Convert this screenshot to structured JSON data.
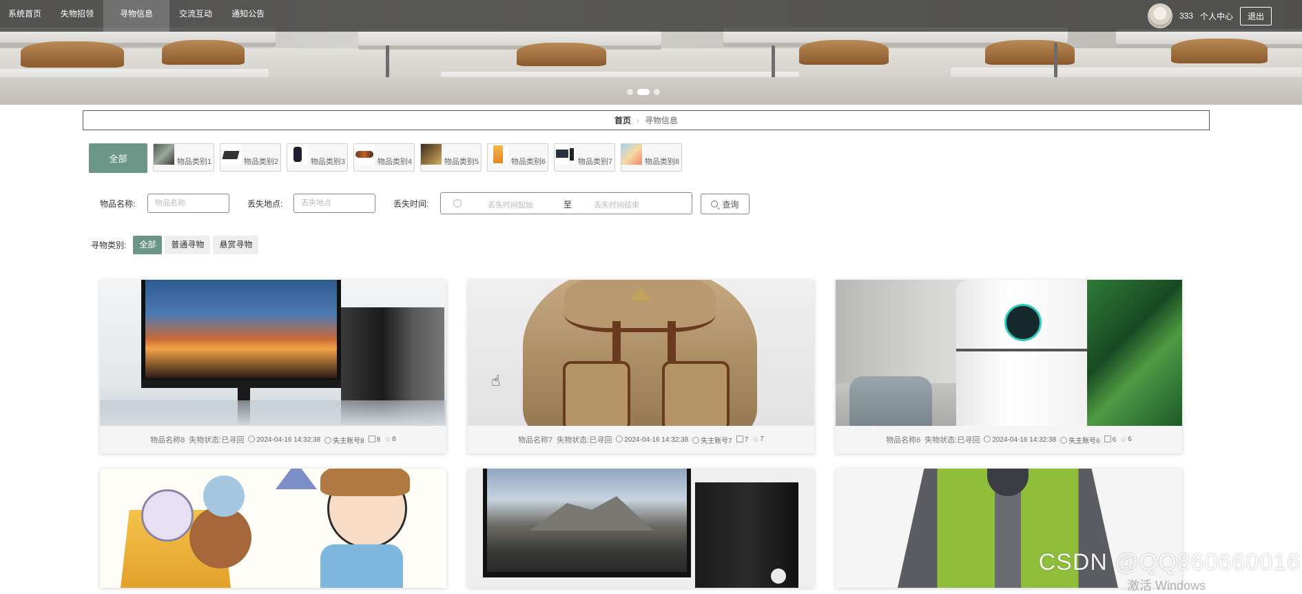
{
  "nav": {
    "items": [
      "系统首页",
      "失物招领",
      "寻物信息",
      "交流互动",
      "通知公告"
    ],
    "active_index": 2,
    "username": "333",
    "profile_label": "个人中心",
    "logout_label": "退出"
  },
  "carousel": {
    "count": 3,
    "active": 1
  },
  "breadcrumb": {
    "home": "首页",
    "sep": "›",
    "current": "寻物信息"
  },
  "categories": {
    "all_label": "全部",
    "items": [
      "物品类别1",
      "物品类别2",
      "物品类别3",
      "物品类别4",
      "物品类别5",
      "物品类别6",
      "物品类别7",
      "物品类别8"
    ]
  },
  "filters": {
    "name_label": "物品名称:",
    "name_placeholder": "物品名称",
    "place_label": "丢失地点:",
    "place_placeholder": "丢失地点",
    "time_label": "丢失时间:",
    "time_start_placeholder": "丢失时间起始",
    "time_to": "至",
    "time_end_placeholder": "丢失时间结束",
    "search_label": "查询"
  },
  "types": {
    "label": "寻物类别:",
    "items": [
      "全部",
      "普通寻物",
      "悬赏寻物"
    ],
    "active_index": 0
  },
  "cards": [
    {
      "name": "物品名称8",
      "status": "失物状态:已寻回",
      "time": "2024-04-16 14:32:38",
      "owner": "失主账号8",
      "likes": "8",
      "favs": "8"
    },
    {
      "name": "物品名称7",
      "status": "失物状态:已寻回",
      "time": "2024-04-16 14:32:38",
      "owner": "失主账号7",
      "likes": "7",
      "favs": "7"
    },
    {
      "name": "物品名称6",
      "status": "失物状态:已寻回",
      "time": "2024-04-16 14:32:38",
      "owner": "失主账号6",
      "likes": "6",
      "favs": "6"
    }
  ],
  "watermark": "CSDN @QQ860660016",
  "os_overlay": "激活 Windows",
  "colors": {
    "accent": "#6c9688",
    "nav_bg": "#282828"
  }
}
